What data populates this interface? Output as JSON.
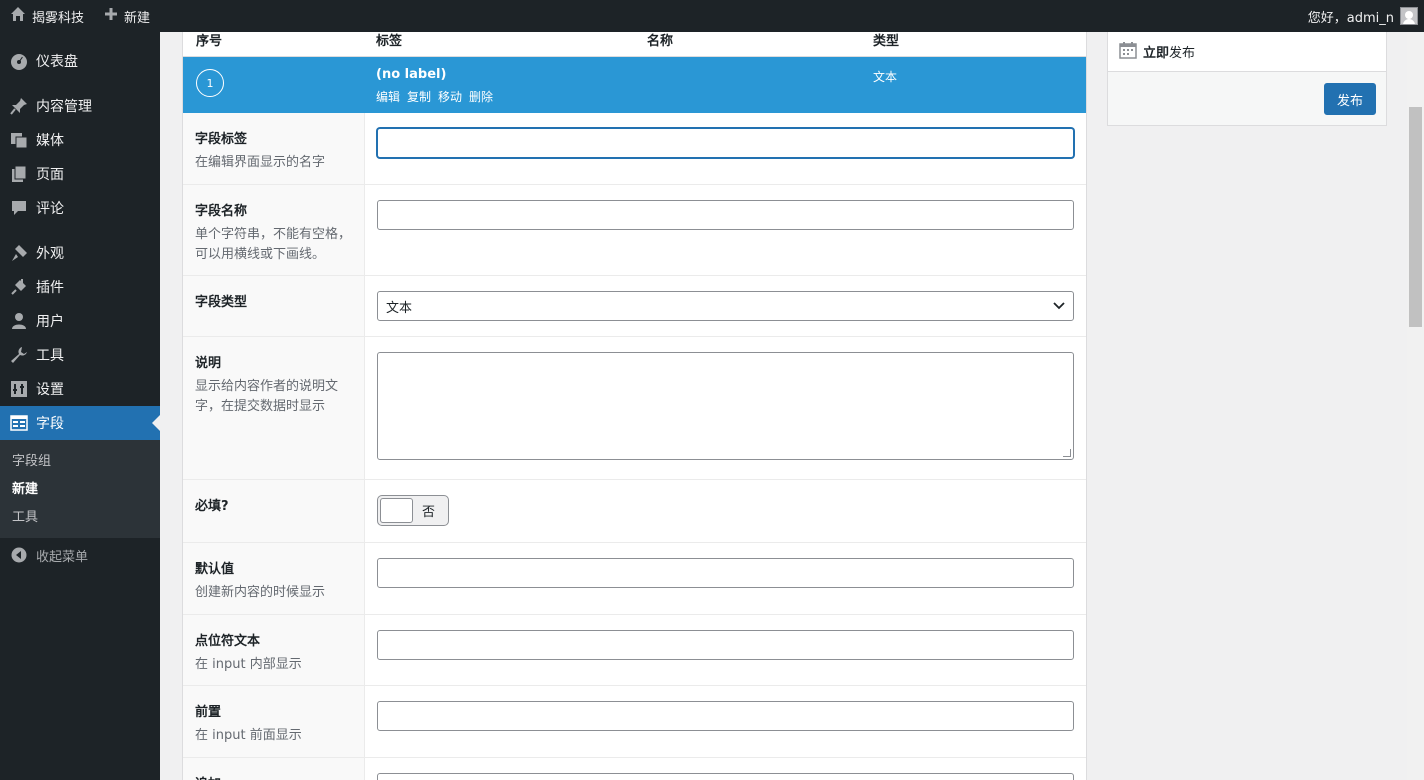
{
  "adminbar": {
    "site_name": "揭雾科技",
    "new_label": "新建",
    "greeting": "您好，admi_n"
  },
  "sidebar": {
    "items": [
      {
        "label": "仪表盘",
        "icon": "dashboard-icon"
      },
      {
        "label": "内容管理",
        "icon": "pin-icon"
      },
      {
        "label": "媒体",
        "icon": "media-icon"
      },
      {
        "label": "页面",
        "icon": "page-icon"
      },
      {
        "label": "评论",
        "icon": "comment-icon"
      },
      {
        "label": "外观",
        "icon": "brush-icon"
      },
      {
        "label": "插件",
        "icon": "plugin-icon"
      },
      {
        "label": "用户",
        "icon": "user-icon"
      },
      {
        "label": "工具",
        "icon": "wrench-icon"
      },
      {
        "label": "设置",
        "icon": "settings-icon"
      },
      {
        "label": "字段",
        "icon": "fields-icon"
      }
    ],
    "submenu": [
      "字段组",
      "新建",
      "工具"
    ],
    "collapse_label": "收起菜单"
  },
  "table_header": {
    "order": "序号",
    "label": "标签",
    "name": "名称",
    "type": "类型"
  },
  "field": {
    "order": "1",
    "label": "(no label)",
    "actions": [
      "编辑",
      "复制",
      "移动",
      "删除"
    ],
    "type": "文本"
  },
  "settings": {
    "field_label": {
      "title": "字段标签",
      "desc": "在编辑界面显示的名字"
    },
    "field_name": {
      "title": "字段名称",
      "desc": "单个字符串，不能有空格，可以用横线或下画线。"
    },
    "field_type": {
      "title": "字段类型",
      "value": "文本"
    },
    "instructions": {
      "title": "说明",
      "desc": "显示给内容作者的说明文字，在提交数据时显示"
    },
    "required": {
      "title": "必填?",
      "value": "否"
    },
    "default_value": {
      "title": "默认值",
      "desc": "创建新内容的时候显示"
    },
    "placeholder": {
      "title": "点位符文本",
      "desc": "在 input 内部显示"
    },
    "prepend": {
      "title": "前置",
      "desc": "在 input 前面显示"
    },
    "append": {
      "title": "追加"
    }
  },
  "publish": {
    "when_bold": "立即",
    "when_rest": "发布",
    "button": "发布"
  },
  "colors": {
    "accent": "#2271b1",
    "row_highlight": "#2a97d5",
    "admin_dark": "#1d2327"
  }
}
